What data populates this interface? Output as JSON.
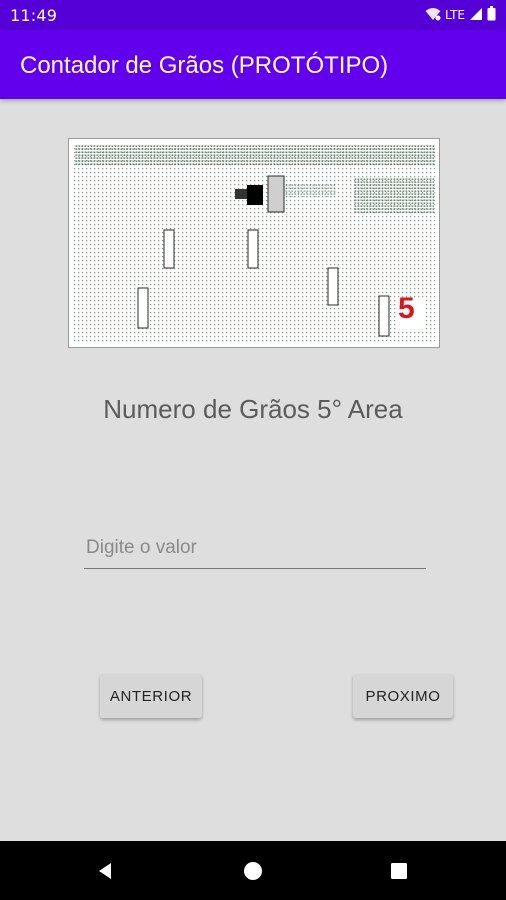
{
  "status_bar": {
    "time": "11:49",
    "network": "LTE",
    "icons": [
      "wifi-icon",
      "signal-icon",
      "battery-icon"
    ]
  },
  "app_bar": {
    "title": "Contador de Grãos (PROTÓTIPO)",
    "color": "#6200ee",
    "status_color": "#5400d6"
  },
  "main": {
    "image": {
      "area_label": "5",
      "label_color": "#e0121a"
    },
    "area_title": "Numero de Grãos 5° Area",
    "input": {
      "value": "",
      "placeholder": "Digite o valor"
    },
    "buttons": {
      "previous_label": "ANTERIOR",
      "next_label": "PROXIMO"
    }
  },
  "nav_bar": {
    "icons": [
      "back-icon",
      "home-icon",
      "recents-icon"
    ]
  }
}
